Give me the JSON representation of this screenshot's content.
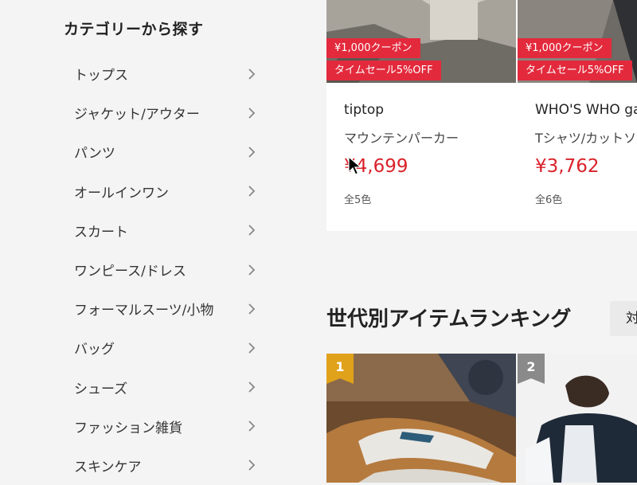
{
  "sidebar": {
    "title": "カテゴリーから探す",
    "items": [
      {
        "label": "トップス"
      },
      {
        "label": "ジャケット/アウター"
      },
      {
        "label": "パンツ"
      },
      {
        "label": "オールインワン"
      },
      {
        "label": "スカート"
      },
      {
        "label": "ワンピース/ドレス"
      },
      {
        "label": "フォーマルスーツ/小物"
      },
      {
        "label": "バッグ"
      },
      {
        "label": "シューズ"
      },
      {
        "label": "ファッション雑貨"
      },
      {
        "label": "スキンケア"
      }
    ]
  },
  "products": [
    {
      "coupon": "¥1,000クーポン",
      "sale": "タイムセール5%OFF",
      "brand": "tiptop",
      "name": "マウンテンパーカー",
      "price": "¥4,699",
      "colors": "全5色"
    },
    {
      "coupon": "¥1,000クーポン",
      "sale": "タイムセール5%OFF",
      "brand": "WHO'S WHO gallery",
      "name": "Tシャツ/カットソー",
      "price": "¥3,762",
      "colors": "全6色"
    }
  ],
  "ranking": {
    "title": "世代別アイテムランキング",
    "button_label": "対象",
    "items": [
      {
        "rank": "1"
      },
      {
        "rank": "2"
      }
    ]
  },
  "colors": {
    "badge_red": "#e32a3c",
    "price_red": "#d9222a",
    "rank1_gold": "#e0a21b",
    "rank2_gray": "#8a8a8a"
  }
}
